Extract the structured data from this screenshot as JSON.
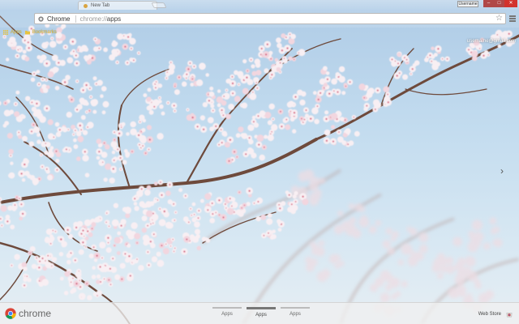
{
  "window": {
    "tab_title": "New Tab",
    "profile_label": "Username",
    "controls": {
      "minimize": "–",
      "maximize": "□",
      "close": "✕"
    }
  },
  "toolbar": {
    "back_icon": "back-arrow-icon",
    "forward_icon": "forward-arrow-icon",
    "reload_icon": "reload-icon",
    "omnibox": {
      "chip_label": "Chrome",
      "url_scheme": "chrome://",
      "url_path": "apps"
    },
    "star_icon": "star-icon",
    "menu_icon": "hamburger-menu-icon"
  },
  "bookmarks": [
    {
      "label": "Apps",
      "icon": "apps-grid-icon"
    },
    {
      "label": "Bookmarks",
      "icon": "folder-icon"
    }
  ],
  "user": {
    "label": "username@gmail.com"
  },
  "footer": {
    "brand": "chrome",
    "pages": [
      {
        "label": "Apps",
        "active": false
      },
      {
        "label": "Apps",
        "active": true
      },
      {
        "label": "Apps",
        "active": false
      }
    ],
    "webstore_label": "Web Store"
  },
  "colors": {
    "sky_top": "#aecbe6",
    "blossom": "#f7eef2",
    "blossom_pink": "#d86b86",
    "branch": "#6e4a3c",
    "bookmark_text": "#e7c23f",
    "close_red": "#d2322d"
  }
}
